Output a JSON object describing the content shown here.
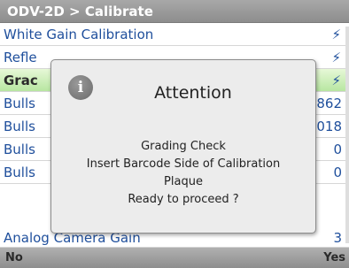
{
  "header": {
    "title": "ODV-2D > Calibrate"
  },
  "list": {
    "rows": [
      {
        "label": "White Gain Calibration",
        "value": "",
        "icon": "lightning-icon"
      },
      {
        "label": "Refle",
        "value": "",
        "icon": "lightning-icon"
      },
      {
        "label": "Grac",
        "value": "",
        "icon": "lightning-icon",
        "selected": true
      },
      {
        "label": "Bulls",
        "value": "862"
      },
      {
        "label": "Bulls",
        "value": "018"
      },
      {
        "label": "Bulls",
        "value": "0"
      },
      {
        "label": "Bulls",
        "value": "0"
      },
      {
        "label": "Analog Camera Gain",
        "value": "3"
      }
    ]
  },
  "dialog": {
    "title": "Attention",
    "icon": "info-icon",
    "icon_glyph": "i",
    "line1": "Grading Check",
    "line2": "Insert Barcode Side of Calibration",
    "line3": "Plaque",
    "line4": "Ready to proceed ?"
  },
  "softkeys": {
    "left": "No",
    "right": "Yes"
  },
  "colors": {
    "accent_text": "#1f4f9c",
    "selected_row": "#b7e6a1",
    "bar": "#9a9a9a"
  }
}
